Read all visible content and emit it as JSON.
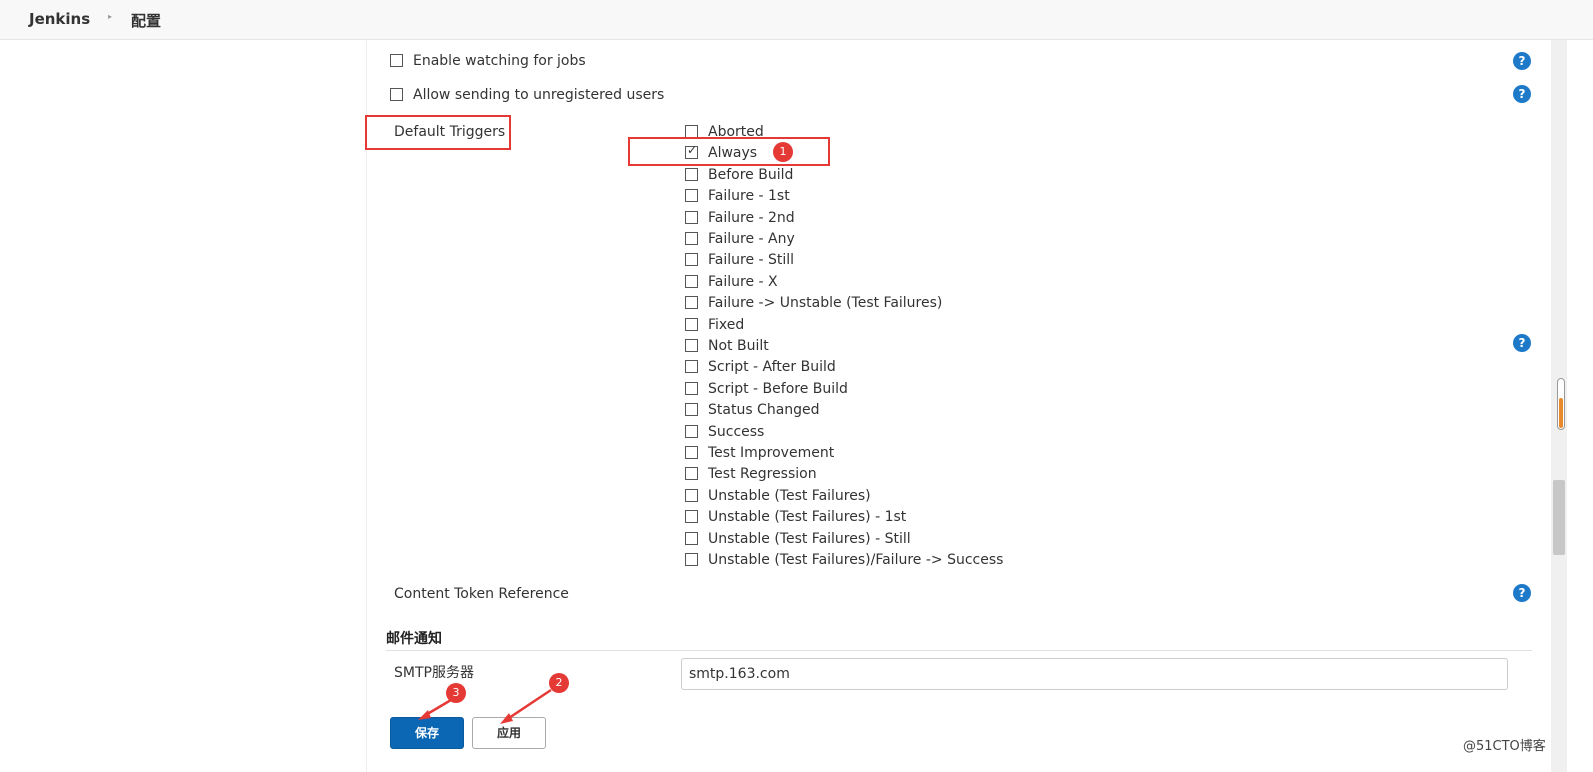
{
  "header": {
    "brand": "Jenkins",
    "breadcrumb_sep": "▸",
    "page": "配置"
  },
  "options": {
    "enable_watching": "Enable watching for jobs",
    "allow_unregistered": "Allow sending to unregistered users"
  },
  "default_triggers": {
    "label": "Default Triggers",
    "items": [
      {
        "label": "Aborted",
        "checked": false
      },
      {
        "label": "Always",
        "checked": true
      },
      {
        "label": "Before Build",
        "checked": false
      },
      {
        "label": "Failure - 1st",
        "checked": false
      },
      {
        "label": "Failure - 2nd",
        "checked": false
      },
      {
        "label": "Failure - Any",
        "checked": false
      },
      {
        "label": "Failure - Still",
        "checked": false
      },
      {
        "label": "Failure - X",
        "checked": false
      },
      {
        "label": "Failure -> Unstable (Test Failures)",
        "checked": false
      },
      {
        "label": "Fixed",
        "checked": false
      },
      {
        "label": "Not Built",
        "checked": false
      },
      {
        "label": "Script - After Build",
        "checked": false
      },
      {
        "label": "Script - Before Build",
        "checked": false
      },
      {
        "label": "Status Changed",
        "checked": false
      },
      {
        "label": "Success",
        "checked": false
      },
      {
        "label": "Test Improvement",
        "checked": false
      },
      {
        "label": "Test Regression",
        "checked": false
      },
      {
        "label": "Unstable (Test Failures)",
        "checked": false
      },
      {
        "label": "Unstable (Test Failures) - 1st",
        "checked": false
      },
      {
        "label": "Unstable (Test Failures) - Still",
        "checked": false
      },
      {
        "label": "Unstable (Test Failures)/Failure -> Success",
        "checked": false
      }
    ]
  },
  "content_token": "Content Token Reference",
  "mail": {
    "section_title": "邮件通知",
    "smtp_label": "SMTP服务器",
    "smtp_value": "smtp.163.com"
  },
  "buttons": {
    "save": "保存",
    "apply": "应用"
  },
  "help_glyph": "?",
  "annotations": {
    "badge1": "1",
    "badge2": "2",
    "badge3": "3",
    "color": "#e53935"
  },
  "watermark": "@51CTO博客",
  "colors": {
    "primary": "#0b66b3",
    "help": "#1e7ac9",
    "annotation": "#e53935"
  }
}
